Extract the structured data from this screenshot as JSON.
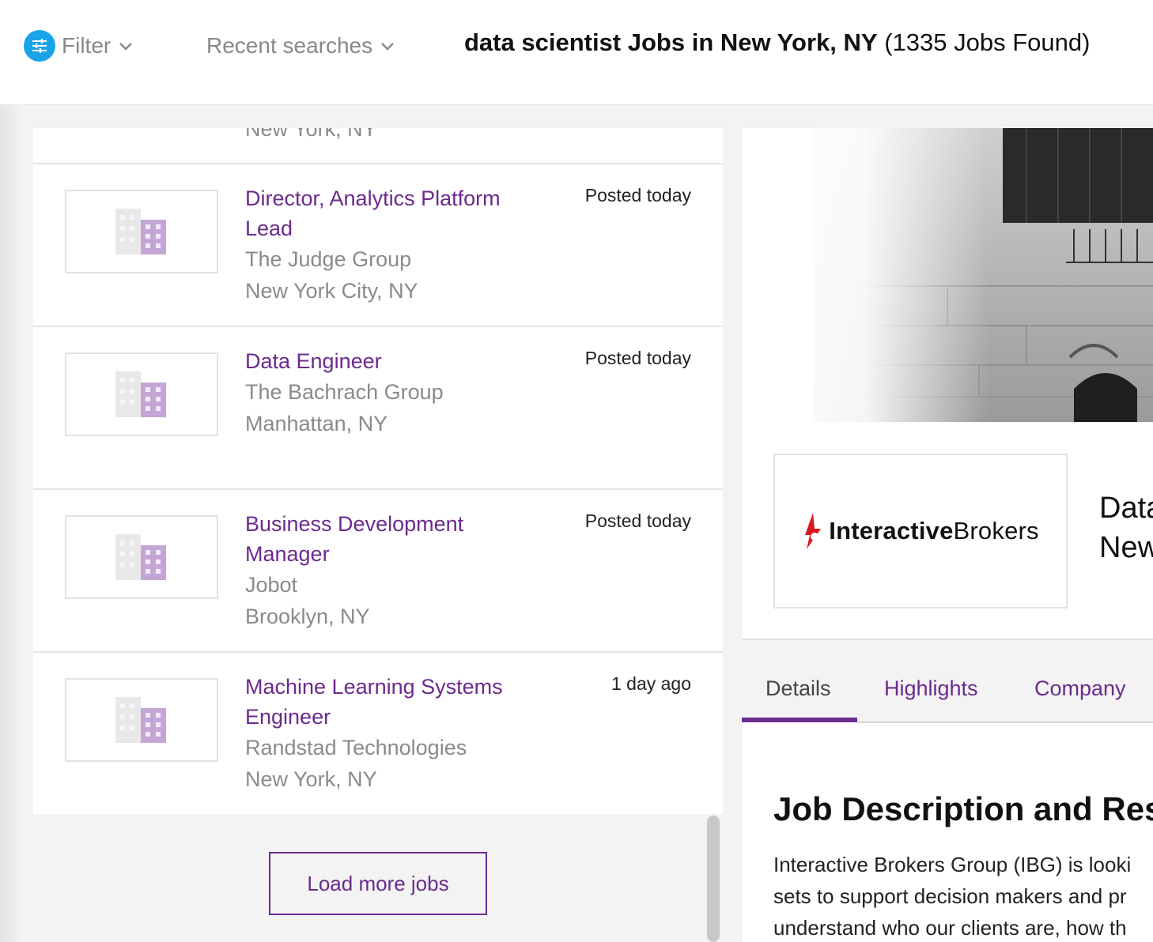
{
  "header": {
    "filter_label": "Filter",
    "recent_searches_label": "Recent searches",
    "results_title": "data scientist Jobs in New York, NY",
    "results_count": "(1335 Jobs Found)"
  },
  "job_list": {
    "partial_location": "New York, NY",
    "jobs": [
      {
        "title": "Director, Analytics Platform Lead",
        "company": "The Judge Group",
        "location": "New York City, NY",
        "posted": "Posted today"
      },
      {
        "title": "Data Engineer",
        "company": "The Bachrach Group",
        "location": "Manhattan, NY",
        "posted": "Posted today"
      },
      {
        "title": "Business Development Manager",
        "company": "Jobot",
        "location": "Brooklyn, NY",
        "posted": "Posted today"
      },
      {
        "title": "Machine Learning Systems Engineer",
        "company": "Randstad Technologies",
        "location": "New York, NY",
        "posted": "1 day ago"
      }
    ],
    "load_more_label": "Load more jobs"
  },
  "detail": {
    "company_logo_text_bold": "Interactive",
    "company_logo_text": "Brokers",
    "heading_line1": "Data",
    "heading_line2": "New",
    "tabs": [
      {
        "label": "Details",
        "active": true
      },
      {
        "label": "Highlights",
        "active": false
      },
      {
        "label": "Company",
        "active": false
      }
    ],
    "description_title": "Job Description and Res",
    "description_lines": [
      "Interactive Brokers Group (IBG) is looki",
      "sets to support decision makers and pr",
      "understand who our clients are, how th"
    ]
  },
  "colors": {
    "accent": "#6b2a8e",
    "filter_icon_bg": "#1aa4e8",
    "brand_red": "#d71920"
  },
  "icons": {
    "filter": "filter-sliders-icon",
    "chevron": "chevron-down-icon",
    "company_placeholder": "building-icon"
  }
}
